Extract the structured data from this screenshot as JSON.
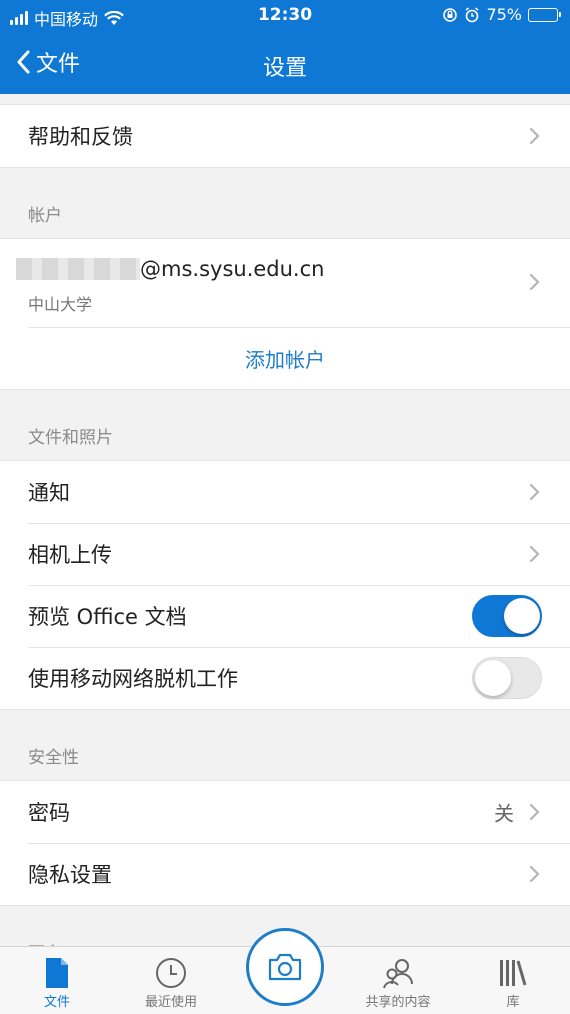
{
  "status_bar": {
    "carrier": "中国移动",
    "time": "12:30",
    "battery": "75%",
    "battery_level": 0.75
  },
  "nav": {
    "back_label": "文件",
    "title": "设置"
  },
  "help_row": {
    "label": "帮助和反馈"
  },
  "account_section": {
    "title": "帐户",
    "email": "@ms.sysu.edu.cn",
    "organization": "中山大学",
    "add_account": "添加帐户"
  },
  "files_section": {
    "title": "文件和照片",
    "notifications": "通知",
    "camera_upload": "相机上传",
    "preview_office": "预览 Office 文档",
    "preview_office_on": true,
    "offline_mobile": "使用移动网络脱机工作",
    "offline_mobile_on": false
  },
  "security_section": {
    "title": "安全性",
    "passcode": "密码",
    "passcode_value": "关",
    "privacy": "隐私设置"
  },
  "more_section": {
    "title": "更多"
  },
  "tabbar": {
    "files": "文件",
    "recent": "最近使用",
    "shared": "共享的内容",
    "library": "库"
  },
  "colors": {
    "accent": "#0f78d4",
    "link": "#1e7dc8"
  }
}
